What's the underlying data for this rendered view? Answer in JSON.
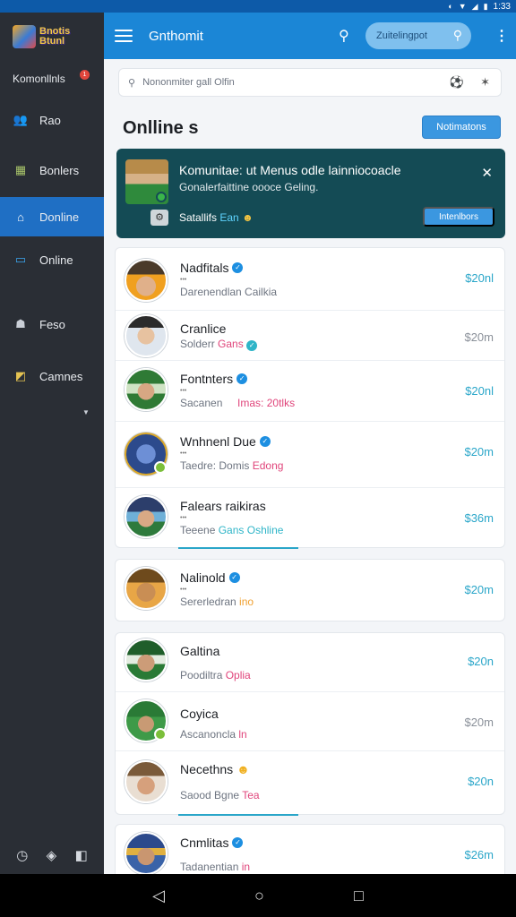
{
  "status_bar": {
    "time": "1:33"
  },
  "sidebar": {
    "logo_text": "Bnotis\nBtunl",
    "items": [
      {
        "label": "Komonllnls",
        "icon": "menu-icon",
        "badge": "1"
      },
      {
        "label": "Rao",
        "icon": "users-icon"
      },
      {
        "label": "Bonlers",
        "icon": "grid-icon"
      },
      {
        "label": "Donline",
        "icon": "home-icon",
        "active": true
      },
      {
        "label": "Online",
        "icon": "monitor-icon"
      },
      {
        "label": "Feso",
        "icon": "person-icon"
      },
      {
        "label": "Camnes",
        "icon": "folder-icon"
      }
    ]
  },
  "topbar": {
    "title": "Gnthomit",
    "pill_text": "Zuitelingpot"
  },
  "main": {
    "search_placeholder": "Nononmiter gall Olfin",
    "section_title": "Onlline s",
    "notifications_button": "Notimatons",
    "promo": {
      "title": "Komunitae: ut Menus odle lainniocoacle",
      "subtitle": "Gonalerfaittine oooce Geling.",
      "status_prefix": "Satallifs",
      "status_highlight": "Ean",
      "button": "Intenlbors"
    },
    "cards": [
      {
        "rows": [
          {
            "name": "Nadfitals",
            "verified": true,
            "sub": "Darenendlan Cailkia",
            "price": "$20nl",
            "price_grey": false
          },
          {
            "name": "Cranlice",
            "verified": false,
            "sub_prefix": "Solderr",
            "sub_accent": "Gans",
            "price": "$20m",
            "price_grey": true
          },
          {
            "name": "Fontnters",
            "verified": true,
            "sub_prefix": "Sacanen",
            "sub_accent": "Imas: 20tlks",
            "price": "$20nl",
            "price_grey": false
          },
          {
            "name": "Wnhnenl Due",
            "verified": true,
            "sub_prefix": "Taedre: Domis",
            "sub_accent": "Edong",
            "price": "$20m",
            "price_grey": false
          },
          {
            "name": "Falears raikiras",
            "verified": false,
            "sub_prefix": "Teeene",
            "sub_accent": "Gans Oshline",
            "price": "$36m",
            "price_grey": false
          }
        ]
      },
      {
        "rows": [
          {
            "name": "Nalinold",
            "verified": true,
            "sub_prefix": "Sererledran",
            "sub_accent": "ino",
            "price": "$20m",
            "price_grey": false
          }
        ]
      },
      {
        "rows": [
          {
            "name": "Galtina",
            "verified": false,
            "sub_prefix": "Poodiltra",
            "sub_accent": "Oplia",
            "price": "$20n",
            "price_grey": false
          },
          {
            "name": "Coyica",
            "verified": false,
            "sub_prefix": "Ascanoncla",
            "sub_accent": "ln",
            "price": "$20m",
            "price_grey": true
          },
          {
            "name": "Necethns",
            "verified": false,
            "sub_prefix": "Saood Bgne",
            "sub_accent": "Tea",
            "price": "$20n",
            "price_grey": false
          }
        ]
      },
      {
        "rows": [
          {
            "name": "Cnmlitas",
            "verified": true,
            "sub_prefix": "Tadanentian",
            "sub_accent": "in",
            "price": "$26m",
            "price_grey": false
          }
        ]
      }
    ]
  },
  "colors": {
    "accent": "#1b86d6",
    "sidebar": "#2a2e35",
    "promo": "#144b55",
    "price": "#2aa6c9"
  }
}
